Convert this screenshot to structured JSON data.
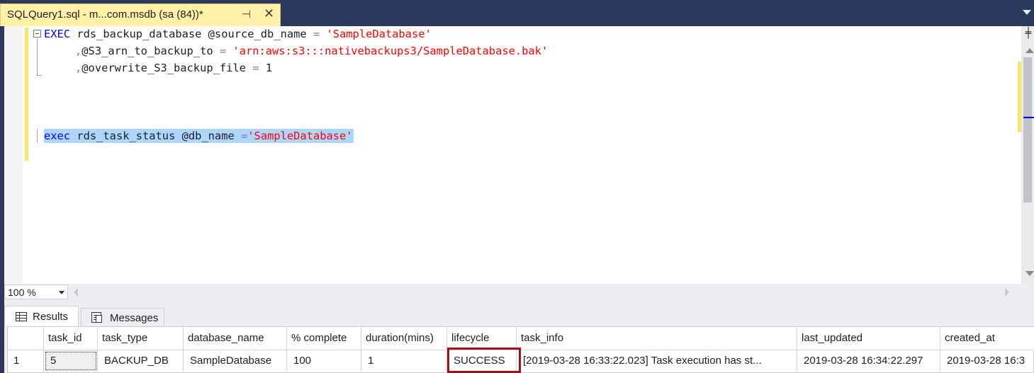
{
  "tab": {
    "title": "SQLQuery1.sql - m...com.msdb (sa (84))*",
    "pin_glyph": "⊣",
    "close_glyph": "✕"
  },
  "editor": {
    "line1": {
      "kw": "EXEC",
      "text1": " rds_backup_database @source_db_name ",
      "op": "=",
      "space": " ",
      "str": "'SampleDatabase'"
    },
    "line2": {
      "op1": ",",
      "text1": "@S3_arn_to_backup_to ",
      "op2": "=",
      "space": " ",
      "str": "'arn:aws:s3:::nativebackups3/SampleDatabase.bak'"
    },
    "line3": {
      "op1": ",",
      "text1": "@overwrite_S3_backup_file ",
      "op2": "=",
      "text2": " 1"
    },
    "line4": {
      "kw": "exec",
      "text1": " rds_task_status @db_name ",
      "op": "=",
      "str": "'SampleDatabase'"
    },
    "split_glyph": "╪"
  },
  "zoom": {
    "value": "100 %"
  },
  "results": {
    "tabs": [
      {
        "label": "Results"
      },
      {
        "label": "Messages"
      }
    ],
    "columns": [
      "task_id",
      "task_type",
      "database_name",
      "% complete",
      "duration(mins)",
      "lifecycle",
      "task_info",
      "last_updated",
      "created_at"
    ],
    "rows": [
      {
        "row_number": "1",
        "task_id": "5",
        "task_type": "BACKUP_DB",
        "database_name": "SampleDatabase",
        "percent_complete": "100",
        "duration": "1",
        "lifecycle": "SUCCESS",
        "task_info": "[2019-03-28 16:33:22.023] Task execution has st...",
        "last_updated": "2019-03-28 16:34:22.297",
        "created_at": "2019-03-28 16:3"
      }
    ]
  },
  "colors": {
    "tab_active": "#fff1a8",
    "keyword": "#0000ff",
    "string": "#ff0000",
    "selection": "#add6ff",
    "highlight_box": "#a3101a"
  }
}
